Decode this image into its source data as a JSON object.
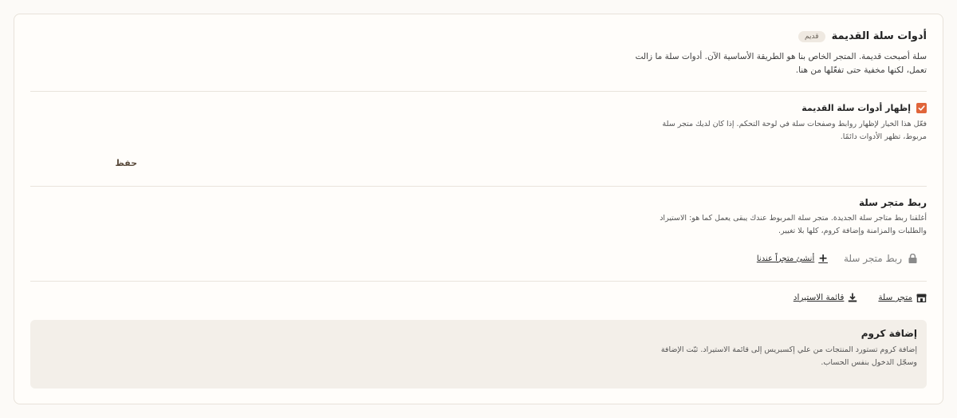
{
  "legacy": {
    "title": "أدوات سلة القديمة",
    "badge": "قديم",
    "description_line1": "سلة أصبحت قديمة. المتجر الخاص بنا هو الطريقة الأساسية الآن. أدوات سلة ما زالت",
    "description_line2": "تعمل، لكنها مخفية حتى تفعّلها من هنا."
  },
  "toggle": {
    "label": "إظهار أدوات سلة القديمة",
    "checked": true,
    "description_line1": "فعّل هذا الخيار لإظهار روابط وصفحات سلة في لوحة التحكم. إذا كان لديك متجر سلة",
    "description_line2": "مربوط، تظهر الأدوات دائمًا.",
    "save_label": "حفظ"
  },
  "connect": {
    "title": "ربط متجر سلة",
    "description_line1": "أغلقنا ربط متاجر سلة الجديدة. متجر سلة المربوط عندك يبقى يعمل كما هو: الاستيراد",
    "description_line2": "والطلبات والمزامنة وإضافة كروم، كلها بلا تغيير.",
    "connect_label": "ربط متجر سلة",
    "create_label": "أنشئ متجراً عندنا"
  },
  "links": {
    "store_label": "متجر سلة",
    "import_label": "قائمة الاستيراد"
  },
  "chrome": {
    "title": "إضافة كروم",
    "description_line1": "إضافة كروم تستورد المنتجات من علي إكسبريس إلى قائمة الاستيراد. ثبّت الإضافة",
    "description_line2": "وسجّل الدخول بنفس الحساب."
  },
  "colors": {
    "accent": "#e0653a",
    "card_bg": "#fffdfa",
    "muted_box": "#f3efe9"
  }
}
